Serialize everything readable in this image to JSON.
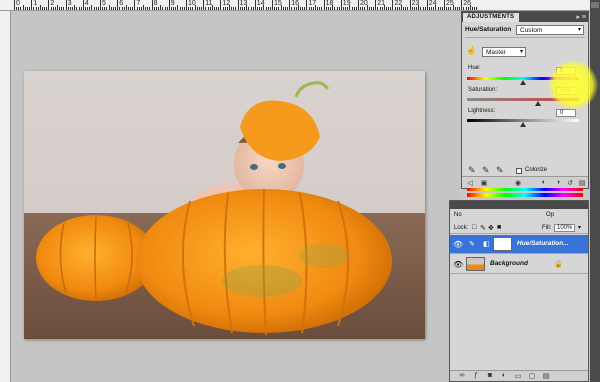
{
  "ruler": {
    "labels": [
      "0",
      "1",
      "2",
      "3",
      "4",
      "5",
      "6",
      "7",
      "8",
      "9",
      "10",
      "11",
      "12",
      "13",
      "14",
      "15",
      "16",
      "17",
      "18",
      "19",
      "20",
      "21",
      "22",
      "23",
      "24",
      "25",
      "26"
    ]
  },
  "adjustments": {
    "tab_label": "ADJUSTMENTS",
    "title": "Hue/Saturation",
    "preset_value": "Custom",
    "channel_value": "Master",
    "hue_label": "Hue:",
    "hue_value": "0",
    "saturation_label": "Saturation:",
    "saturation_value": "+26",
    "lightness_label": "Lightness:",
    "lightness_value": "0",
    "colorize_label": "Colorize"
  },
  "layers": {
    "mode_partial": "No",
    "opacity_partial": "Op",
    "lock_label": "Lock:",
    "fill_label": "Fill:",
    "fill_value": "100%",
    "items": [
      {
        "name": "Hue/Saturation...",
        "active": true
      },
      {
        "name": "Background",
        "active": false
      }
    ]
  },
  "colors": {
    "selection_blue": "#3874d8",
    "highlight_yellow": "#ffff33",
    "panel_bg": "#d6d6d6",
    "dark_bar": "#4a4a4a"
  }
}
